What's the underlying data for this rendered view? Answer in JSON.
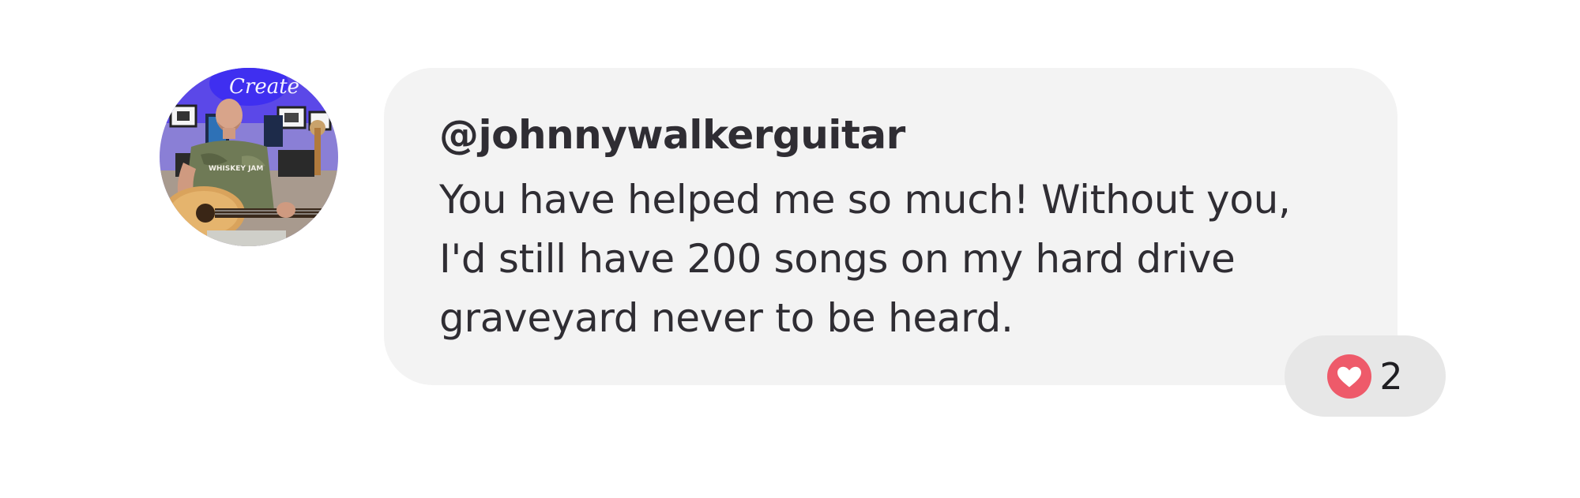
{
  "comment": {
    "avatar": {
      "description_icon": "user-avatar",
      "neon_sign": "Create",
      "shirt_text": "WHISKEY JAM"
    },
    "username": "@johnnywalkerguitar",
    "message": "You have helped me so much! Without you, I'd still have 200 songs on my hard drive graveyard never to be heard.",
    "reaction": {
      "icon": "heart-icon",
      "count": "2",
      "color": "#ee5a6a"
    }
  }
}
